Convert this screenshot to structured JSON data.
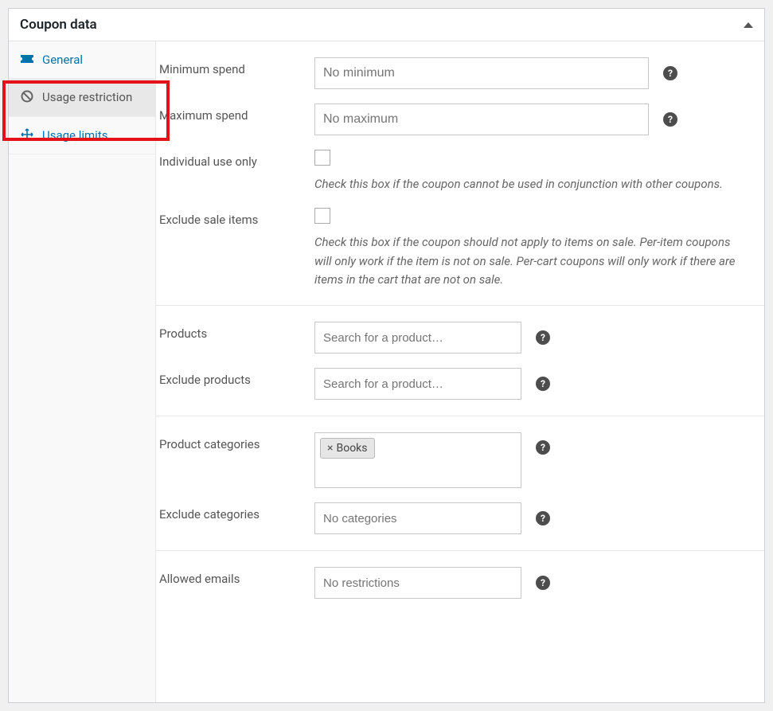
{
  "header": {
    "title": "Coupon data"
  },
  "sidebar": {
    "items": [
      {
        "label": "General",
        "icon": "ticket"
      },
      {
        "label": "Usage restriction",
        "icon": "prohibit"
      },
      {
        "label": "Usage limits",
        "icon": "move"
      }
    ]
  },
  "fields": {
    "min_spend": {
      "label": "Minimum spend",
      "placeholder": "No minimum"
    },
    "max_spend": {
      "label": "Maximum spend",
      "placeholder": "No maximum"
    },
    "individual": {
      "label": "Individual use only",
      "desc": "Check this box if the coupon cannot be used in conjunction with other coupons."
    },
    "exclude_sale": {
      "label": "Exclude sale items",
      "desc": "Check this box if the coupon should not apply to items on sale. Per-item coupons will only work if the item is not on sale. Per-cart coupons will only work if there are items in the cart that are not on sale."
    },
    "products": {
      "label": "Products",
      "placeholder": "Search for a product…"
    },
    "exclude_products": {
      "label": "Exclude products",
      "placeholder": "Search for a product…"
    },
    "categories": {
      "label": "Product categories",
      "tags": [
        {
          "label": "Books"
        }
      ]
    },
    "exclude_categories": {
      "label": "Exclude categories",
      "placeholder": "No categories"
    },
    "allowed_emails": {
      "label": "Allowed emails",
      "placeholder": "No restrictions"
    }
  }
}
